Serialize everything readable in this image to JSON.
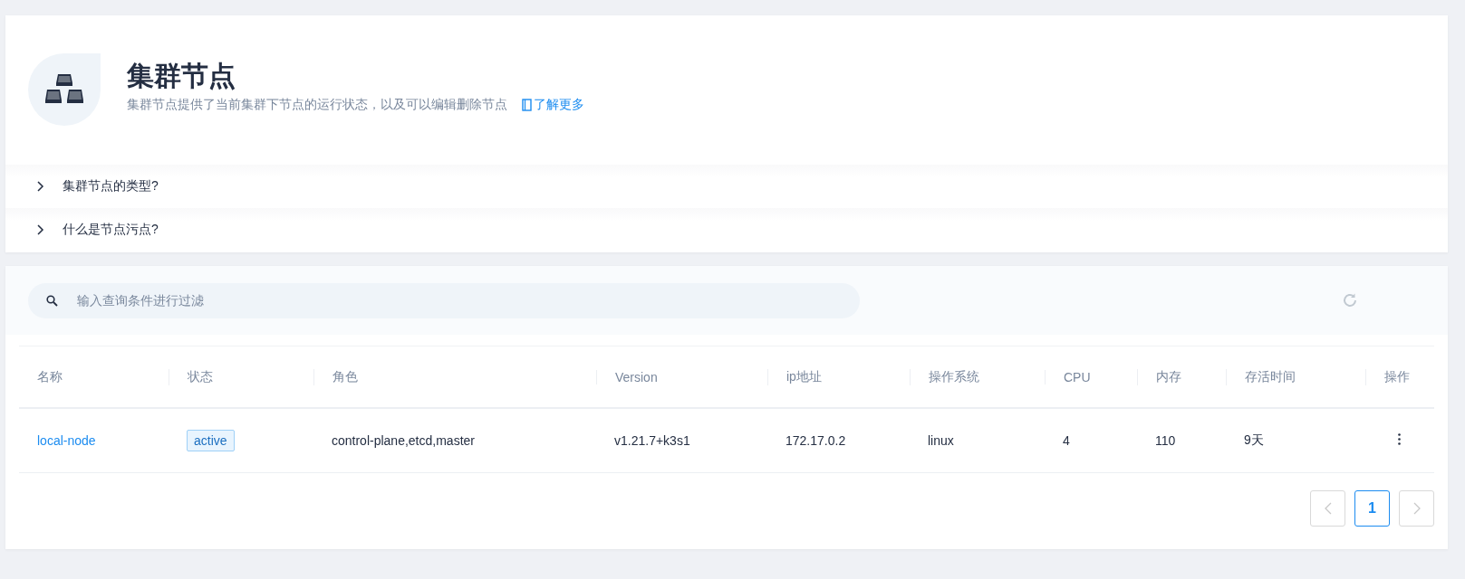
{
  "header": {
    "title": "集群节点",
    "description": "集群节点提供了当前集群下节点的运行状态，以及可以编辑删除节点",
    "learn_more": "了解更多"
  },
  "faq": [
    {
      "question": "集群节点的类型?",
      "expanded": false
    },
    {
      "question": "什么是节点污点?",
      "expanded": false
    }
  ],
  "toolbar": {
    "search": {
      "placeholder": "输入查询条件进行过滤"
    }
  },
  "table": {
    "columns": [
      "名称",
      "状态",
      "角色",
      "Version",
      "ip地址",
      "操作系统",
      "CPU",
      "内存",
      "存活时间",
      "操作"
    ],
    "rows": [
      {
        "name": "local-node",
        "status": "active",
        "role": "control-plane,etcd,master",
        "version": "v1.21.7+k3s1",
        "ip": "172.17.0.2",
        "os": "linux",
        "cpu": "4",
        "memory": "110",
        "uptime": "9天"
      }
    ]
  },
  "pagination": {
    "prev_disabled": true,
    "next_disabled": true,
    "pages": [
      {
        "label": "1",
        "selected": true
      }
    ]
  }
}
